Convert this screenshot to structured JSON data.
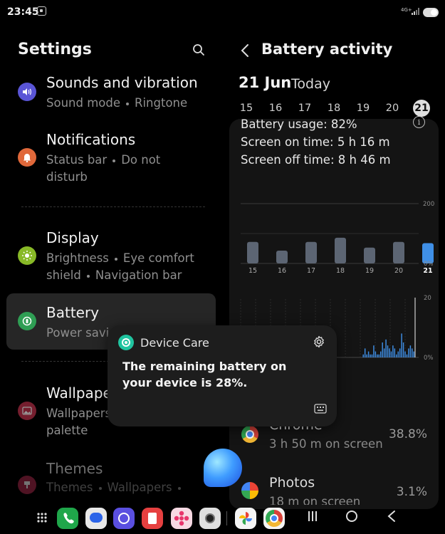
{
  "status": {
    "time": "23:45",
    "network": "4G+"
  },
  "settings": {
    "title": "Settings",
    "items": [
      {
        "title": "Sounds and vibration",
        "sub": [
          "Sound mode",
          "Ringtone"
        ],
        "icon": "speaker-icon",
        "color": "#5a55d6"
      },
      {
        "title": "Notifications",
        "sub1": "Status bar",
        "sub2": "Do not",
        "sub3": "disturb",
        "icon": "bell-icon",
        "color": "#e0683a"
      },
      {
        "title": "Display",
        "sub1": "Brightness",
        "sub2": "Eye comfort",
        "sub3": "shield",
        "sub4": "Navigation bar",
        "icon": "sun-icon",
        "color": "#88b927"
      },
      {
        "title": "Battery",
        "sub": "Power savi",
        "icon": "battery-icon",
        "color": "#2f9e54"
      },
      {
        "title": "Wallpape",
        "sub1": "Wallpapers",
        "sub2": "palette",
        "icon": "image-icon",
        "color": "#c3334d"
      },
      {
        "title": "Themes",
        "sub1": "Themes",
        "sub2": "Wallpapers",
        "icon": "brush-icon",
        "color": "#b02c4e"
      }
    ]
  },
  "battery": {
    "title": "Battery activity",
    "date": "21 Jun",
    "today": "Today",
    "days": [
      "15",
      "16",
      "17",
      "18",
      "19",
      "20",
      "21"
    ],
    "usage": "Battery usage: 82%",
    "screen_on": "Screen on time: 5 h 16 m",
    "screen_off": "Screen off time: 8 h 46 m",
    "apps": [
      {
        "name": "Chrome",
        "sub": "3 h 50 m on screen",
        "pct": "38.8%"
      },
      {
        "name": "Photos",
        "sub": "18 m on screen",
        "pct": "3.1%"
      }
    ]
  },
  "chart_data": [
    {
      "type": "bar",
      "categories": [
        "15",
        "16",
        "17",
        "18",
        "19",
        "20",
        "21"
      ],
      "values": [
        72,
        43,
        72,
        86,
        53,
        72,
        68
      ],
      "ylim": [
        0,
        200
      ],
      "tick_labels": [
        "200",
        "0%"
      ],
      "highlight": "21",
      "colors": {
        "bars": "#5c6573",
        "selected": "#3f8fe6"
      }
    },
    {
      "type": "bar",
      "values": [
        0,
        0,
        0,
        0,
        0,
        0,
        0,
        0,
        0,
        0,
        0,
        0,
        0,
        0,
        0,
        0,
        0,
        0,
        0,
        0,
        0,
        0,
        0,
        0,
        0,
        0,
        0,
        0,
        0,
        0,
        0,
        0,
        0,
        0,
        0,
        0,
        0,
        0,
        0,
        0,
        0,
        0,
        0,
        0,
        0,
        0,
        0,
        0,
        0,
        0,
        0,
        0,
        0,
        0,
        0,
        0,
        0,
        0,
        0,
        0,
        0,
        0,
        0,
        0,
        0,
        0,
        0,
        0,
        0,
        0,
        1,
        3,
        1,
        2,
        1,
        1,
        4,
        2,
        1,
        1,
        2,
        5,
        3,
        6,
        4,
        3,
        2,
        4,
        3,
        1,
        2,
        3,
        8,
        5,
        2,
        1,
        3,
        4,
        3,
        2
      ],
      "ylim": [
        0,
        20
      ],
      "tick_labels": [
        "20",
        "0%"
      ],
      "colors": {
        "bars": "#3f8fe6"
      }
    }
  ],
  "popup": {
    "app": "Device Care",
    "message": "The remaining battery on your device is 28%."
  },
  "colors": {
    "accent": "#3f8fe6",
    "device_care": "#20c4a0"
  }
}
